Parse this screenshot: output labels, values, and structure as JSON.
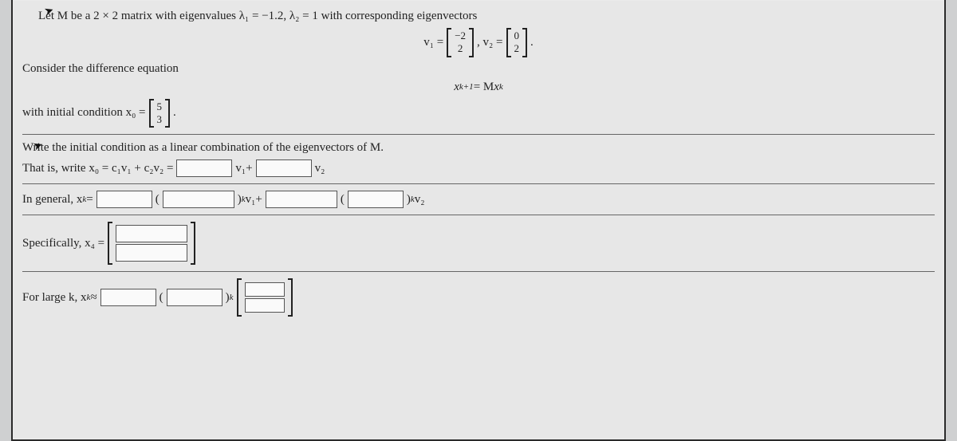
{
  "intro": "Let M be a 2 × 2 matrix with eigenvalues λ₁ = −1.2, λ₂ = 1 with corresponding eigenvectors",
  "v1_label": "v₁ =",
  "v1": [
    "−2",
    "2"
  ],
  "v2_label": ", v₂ =",
  "v2": [
    "0",
    "2"
  ],
  "period": ".",
  "consider": "Consider the difference equation",
  "recurrence_lhs": "x",
  "recurrence_sub1": "k+1",
  "recurrence_mid": " = M",
  "recurrence_sub2": "k",
  "with_initial": "with initial condition x₀ =",
  "x0": [
    "5",
    "3"
  ],
  "write_initial": "Write the initial condition as a linear combination of the eigenvectors of M.",
  "that_is": "That is, write x₀ = c₁v₁ + c₂v₂ =",
  "v1plus": "v₁+",
  "v2_only": "v₂",
  "in_general": "In general, x",
  "in_general_sub": "k",
  "equals": " =",
  "paren_open": "(",
  "paren_close_k": ")",
  "exp_k": "k",
  "v1plus2": " v₁+",
  "v2_end": " v₂",
  "specifically": "Specifically, x₄ =",
  "for_large": "For large k, x",
  "for_large_sub": "k",
  "approx": " ≈"
}
